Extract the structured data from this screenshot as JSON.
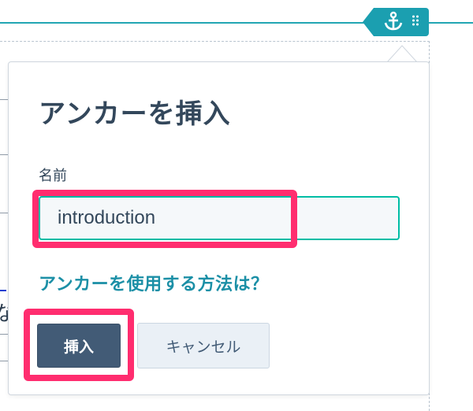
{
  "anchor_toolbar": {
    "icons": [
      "anchor-icon",
      "drag-handle-icon"
    ],
    "color": "#1b9fb0"
  },
  "popover": {
    "title": "アンカーを挿入",
    "name_label": "名前",
    "name_value": "introduction",
    "help_link": "アンカーを使用する方法は？",
    "insert_label": "挿入",
    "cancel_label": "キャンセル"
  },
  "colors": {
    "primary_button": "#425b76",
    "input_focus_border": "#00bda5",
    "link": "#1b8fa6",
    "highlight": "#ff2d6f"
  },
  "background": {
    "partial_char": "な"
  }
}
